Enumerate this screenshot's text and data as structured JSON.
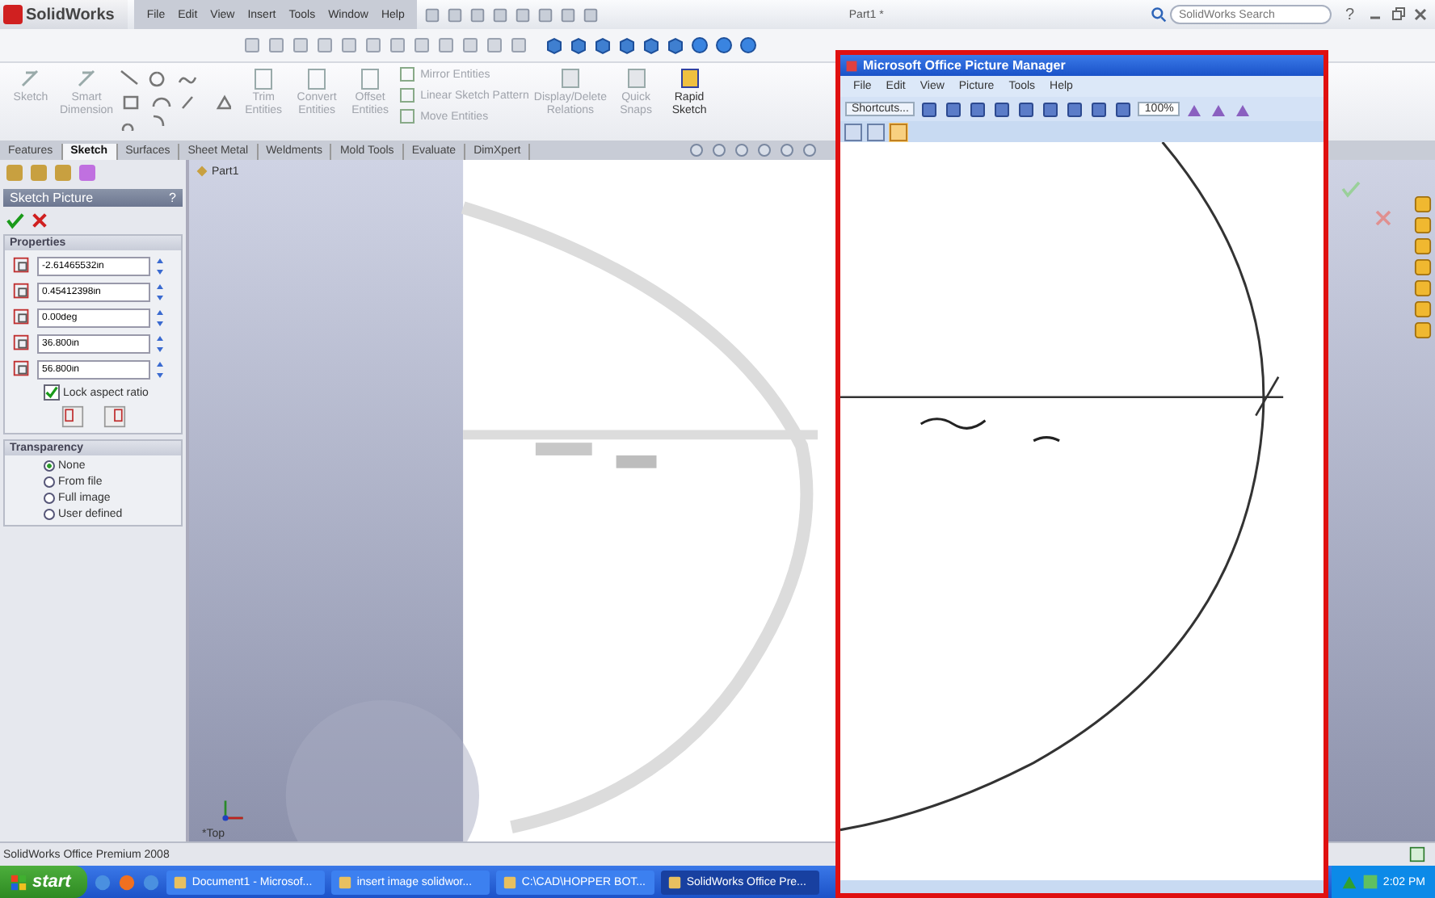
{
  "app": {
    "logo": "SolidWorks",
    "menus": [
      "File",
      "Edit",
      "View",
      "Insert",
      "Tools",
      "Window",
      "Help"
    ],
    "document_title": "Part1 *",
    "search": {
      "placeholder": "SolidWorks Search"
    },
    "help": "?"
  },
  "command_manager": {
    "large": [
      {
        "label": "Sketch",
        "disabled": true
      },
      {
        "label": "Smart Dimension",
        "disabled": true
      }
    ],
    "middle": [
      {
        "label": "Trim Entities",
        "disabled": true
      },
      {
        "label": "Convert Entities",
        "disabled": true
      },
      {
        "label": "Offset Entities",
        "disabled": true
      }
    ],
    "small": [
      {
        "label": "Mirror Entities",
        "disabled": true
      },
      {
        "label": "Linear Sketch Pattern",
        "disabled": true
      },
      {
        "label": "Move Entities",
        "disabled": true
      }
    ],
    "right": [
      {
        "label": "Display/Delete Relations",
        "disabled": true
      },
      {
        "label": "Quick Snaps",
        "disabled": true
      },
      {
        "label": "Rapid Sketch",
        "disabled": false
      }
    ]
  },
  "tabs": [
    {
      "label": "Features",
      "selected": false
    },
    {
      "label": "Sketch",
      "selected": true
    },
    {
      "label": "Surfaces",
      "selected": false
    },
    {
      "label": "Sheet Metal",
      "selected": false
    },
    {
      "label": "Weldments",
      "selected": false
    },
    {
      "label": "Mold Tools",
      "selected": false
    },
    {
      "label": "Evaluate",
      "selected": false
    },
    {
      "label": "DimXpert",
      "selected": false
    }
  ],
  "property_manager": {
    "title": "Sketch Picture",
    "help": "?",
    "properties": {
      "title": "Properties",
      "fields": [
        {
          "value": "-2.61465532in"
        },
        {
          "value": "0.45412398in"
        },
        {
          "value": "0.00deg"
        },
        {
          "value": "36.800in"
        },
        {
          "value": "56.800in"
        }
      ],
      "lock": {
        "label": "Lock aspect ratio",
        "checked": true
      }
    },
    "transparency": {
      "title": "Transparency",
      "options": [
        {
          "label": "None",
          "selected": true
        },
        {
          "label": "From file",
          "selected": false
        },
        {
          "label": "Full image",
          "selected": false
        },
        {
          "label": "User defined",
          "selected": false
        }
      ]
    }
  },
  "tree": {
    "root": "Part1"
  },
  "view_label": "*Top",
  "picture_manager": {
    "title": "Microsoft Office Picture Manager",
    "menus": [
      "File",
      "Edit",
      "View",
      "Picture",
      "Tools",
      "Help"
    ],
    "shortcuts": "Shortcuts...",
    "zoom": "100%"
  },
  "status_bar": "SolidWorks Office Premium 2008",
  "taskbar": {
    "start": "start",
    "tasks": [
      {
        "label": "Document1 - Microsof...",
        "selected": false
      },
      {
        "label": "insert image solidwor...",
        "selected": false
      },
      {
        "label": "C:\\CAD\\HOPPER BOT...",
        "selected": false
      },
      {
        "label": "SolidWorks Office Pre...",
        "selected": true
      }
    ],
    "clock": "2:02 PM"
  }
}
